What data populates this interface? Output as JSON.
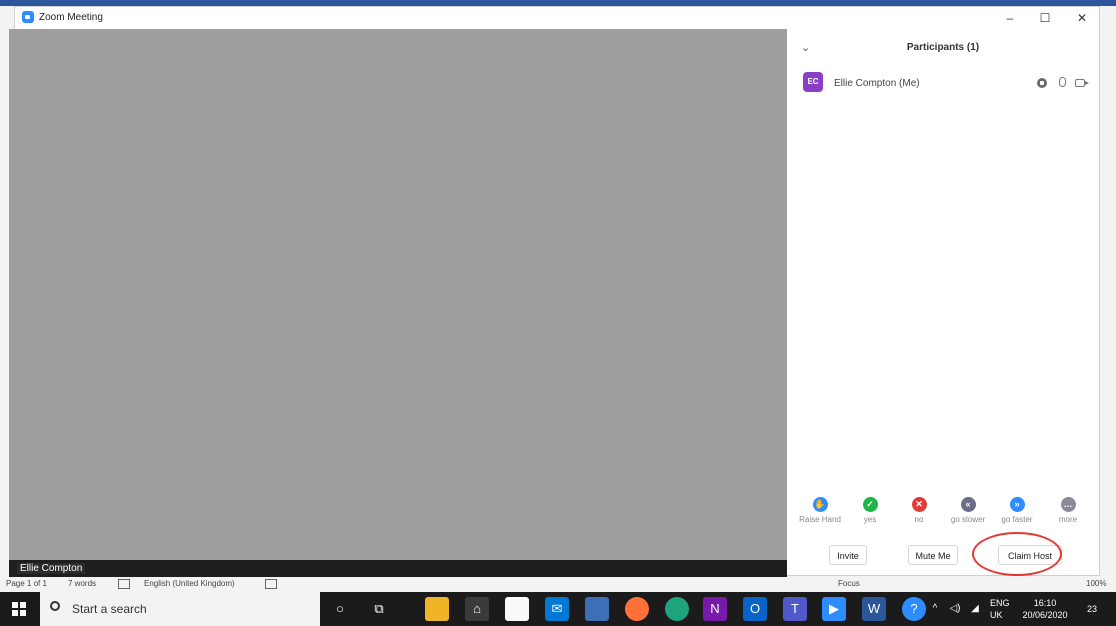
{
  "window": {
    "title": "Zoom Meeting",
    "min": "–",
    "max": "☐",
    "close": "✕"
  },
  "video": {
    "participant_name": "Ellie Compton"
  },
  "participants_panel": {
    "collapse_icon": "chevron-down-icon",
    "title": "Participants (1)",
    "participant": {
      "initials": "EC",
      "name": "Ellie Compton (Me)",
      "avatar_color": "#8a3ec4"
    },
    "reactions": [
      {
        "label": "Raise Hand",
        "color": "#2d8cff",
        "glyph": "✋"
      },
      {
        "label": "yes",
        "color": "#1eb448",
        "glyph": "✓"
      },
      {
        "label": "no",
        "color": "#e53935",
        "glyph": "✕"
      },
      {
        "label": "go slower",
        "color": "#6b6b8a",
        "glyph": "«"
      },
      {
        "label": "go faster",
        "color": "#2d8cff",
        "glyph": "»"
      },
      {
        "label": "more",
        "color": "#8a8a9a",
        "glyph": "…"
      }
    ],
    "buttons": {
      "invite": "Invite",
      "mute": "Mute Me",
      "claim_host": "Claim Host"
    },
    "highlight_color": "#e53935"
  },
  "word_status": {
    "page": "Page 1 of 1",
    "words": "7 words",
    "language": "English (United Kingdom)",
    "focus": "Focus",
    "zoom": "100%"
  },
  "taskbar": {
    "search_placeholder": "Start a search",
    "lang_top": "ENG",
    "lang_bottom": "UK",
    "time": "16:10",
    "date": "20/06/2020",
    "notifications": "23"
  }
}
